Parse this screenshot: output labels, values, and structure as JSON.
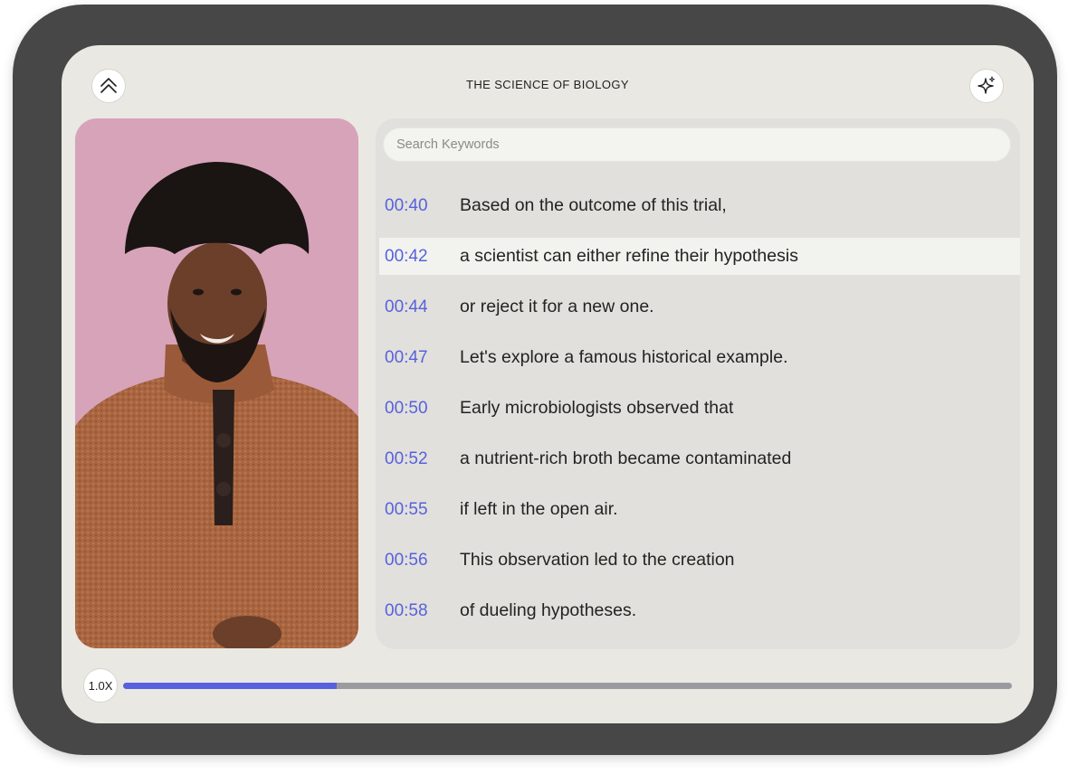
{
  "header": {
    "title": "THE SCIENCE OF BIOLOGY",
    "collapse_icon": "double-chevron-up-icon",
    "ai_icon": "sparkle-icon"
  },
  "search": {
    "placeholder": "Search Keywords",
    "value": ""
  },
  "transcript": {
    "active_index": 1,
    "lines": [
      {
        "time": "00:40",
        "text": "Based on the outcome of this trial,"
      },
      {
        "time": "00:42",
        "text": "a scientist can either refine their hypothesis"
      },
      {
        "time": "00:44",
        "text": "or reject it for a new one."
      },
      {
        "time": "00:47",
        "text": "Let's explore a famous historical example."
      },
      {
        "time": "00:50",
        "text": "Early microbiologists observed that"
      },
      {
        "time": "00:52",
        "text": "a nutrient-rich broth became contaminated"
      },
      {
        "time": "00:55",
        "text": "if left in the open air."
      },
      {
        "time": "00:56",
        "text": "This observation led to the creation"
      },
      {
        "time": "00:58",
        "text": "of dueling hypotheses."
      }
    ]
  },
  "player": {
    "speed_label": "1.0X",
    "progress_fraction": 0.24
  },
  "colors": {
    "accent": "#5861dd",
    "device_frame": "#474747",
    "screen_background": "#e9e8e3",
    "video_background": "#d7a3b9"
  }
}
